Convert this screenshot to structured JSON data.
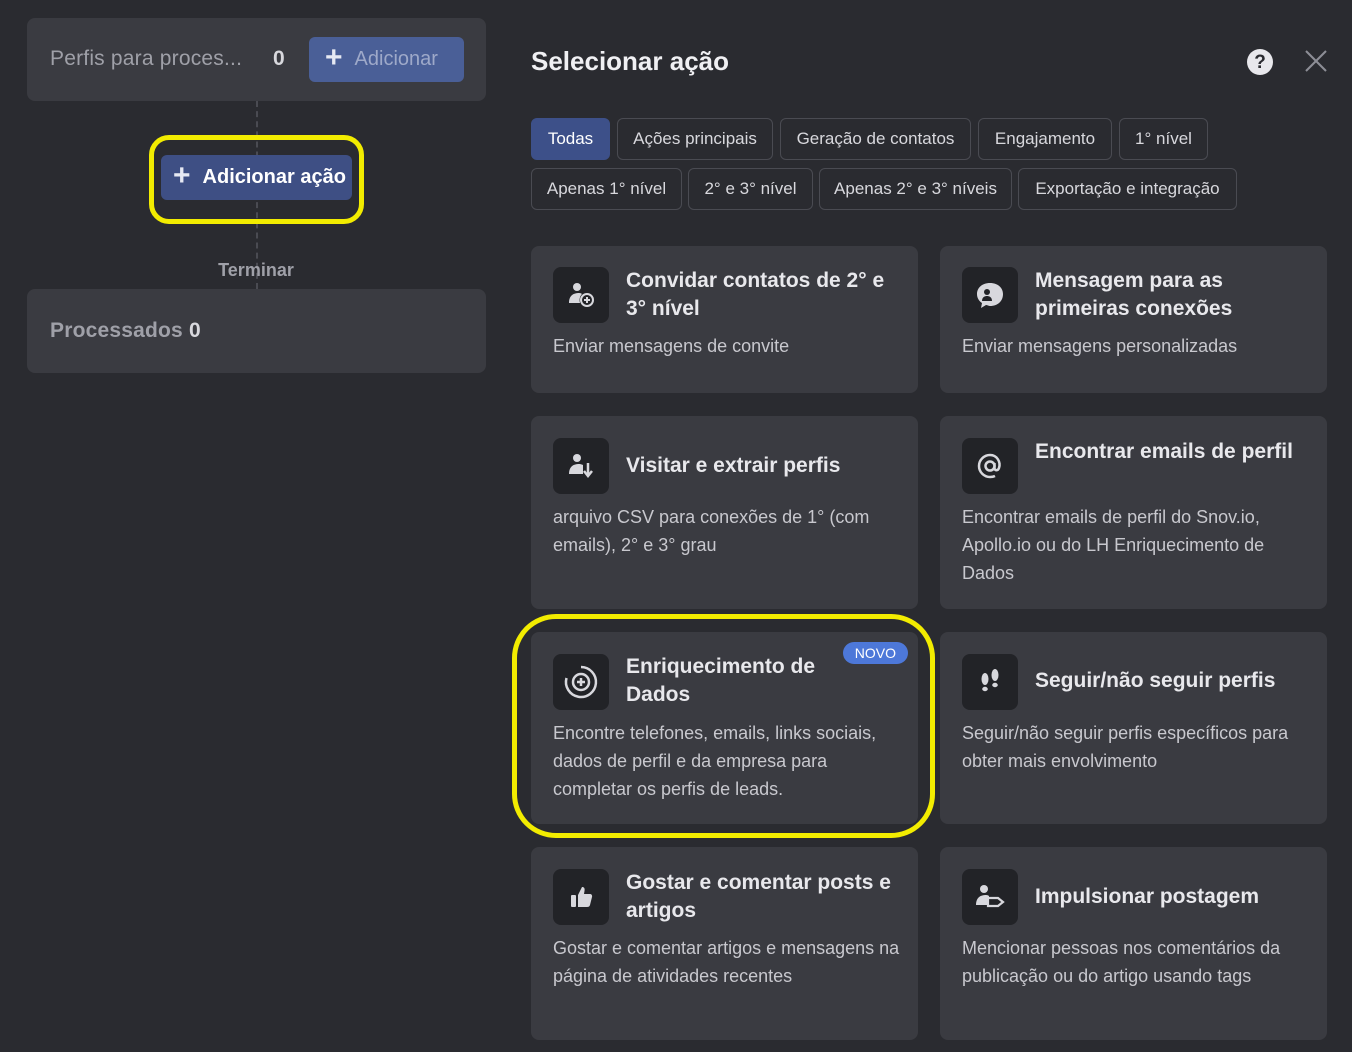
{
  "workflow": {
    "profiles_label": "Perfis para proces...",
    "profiles_count": "0",
    "add_button_label": "Adicionar",
    "add_action_label": "Adicionar ação",
    "finish_label": "Terminar",
    "processed_label": "Processados",
    "processed_count": "0"
  },
  "panel": {
    "title": "Selecionar ação",
    "help_symbol": "?"
  },
  "filters": [
    {
      "label": "Todas",
      "active": true
    },
    {
      "label": "Ações principais"
    },
    {
      "label": "Geração de contatos"
    },
    {
      "label": "Engajamento"
    },
    {
      "label": "1° nível"
    },
    {
      "label": "Apenas 1° nível"
    },
    {
      "label": "2° e 3° nível"
    },
    {
      "label": "Apenas 2° e 3° níveis"
    },
    {
      "label": "Exportação e integração"
    }
  ],
  "cards": [
    {
      "title": "Convidar contatos de 2° e 3° nível",
      "desc": "Enviar mensagens de convite",
      "icon": "user-plus-icon"
    },
    {
      "title": "Mensagem para as primeiras conexões",
      "desc": "Enviar mensagens personalizadas",
      "icon": "chat-user-icon"
    },
    {
      "title": "Visitar e extrair perfis",
      "desc": "arquivo CSV para conexões de 1° (com emails), 2° e 3° grau",
      "icon": "user-download-icon"
    },
    {
      "title": "Encontrar emails de perfil",
      "desc": "Encontrar emails de perfil do Snov.io, Apollo.io ou do LH Enriquecimento de Dados",
      "icon": "at-sign-icon"
    },
    {
      "title": "Enriquecimento de Dados",
      "desc": "Encontre telefones, emails, links sociais, dados de perfil e da empresa para completar os perfis de leads.",
      "icon": "circle-plus-icon",
      "badge": "NOVO"
    },
    {
      "title": "Seguir/não seguir perfis",
      "desc": "Seguir/não seguir perfis específicos para obter mais envolvimento",
      "icon": "footsteps-icon"
    },
    {
      "title": "Gostar e comentar posts e artigos",
      "desc": "Gostar e comentar artigos e mensagens na página de atividades recentes",
      "icon": "thumbs-up-icon"
    },
    {
      "title": "Impulsionar postagem",
      "desc": "Mencionar pessoas nos comentários da publicação ou do artigo usando tags",
      "icon": "user-tag-icon"
    }
  ]
}
